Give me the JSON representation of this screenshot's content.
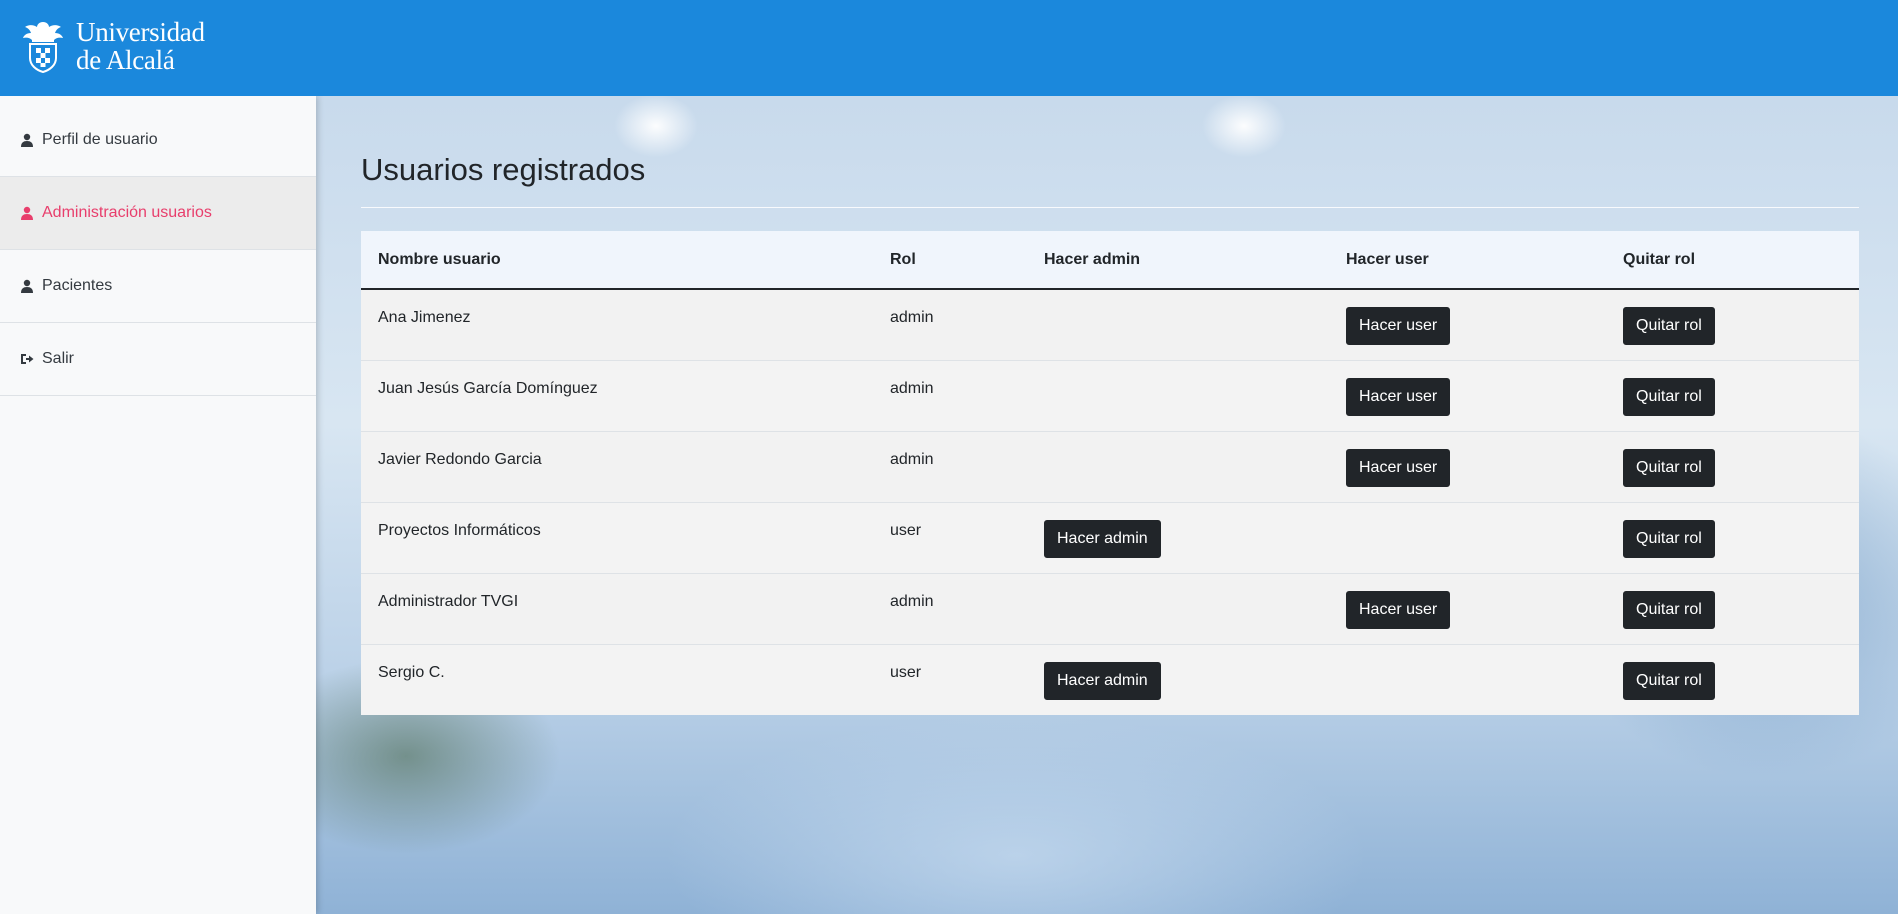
{
  "header": {
    "logo_line1": "Universidad",
    "logo_line2": "de Alcalá",
    "background_color": "#1b88dc"
  },
  "sidebar": {
    "items": [
      {
        "label": "Perfil de usuario",
        "icon": "user-icon",
        "active": false
      },
      {
        "label": "Administración usuarios",
        "icon": "user-icon",
        "active": true
      },
      {
        "label": "Pacientes",
        "icon": "user-icon",
        "active": false
      },
      {
        "label": "Salir",
        "icon": "sign-out-icon",
        "active": false
      }
    ],
    "active_color": "#e83e6c"
  },
  "main": {
    "title": "Usuarios registrados",
    "table": {
      "headers": [
        "Nombre usuario",
        "Rol",
        "Hacer admin",
        "Hacer user",
        "Quitar rol"
      ],
      "rows": [
        {
          "name": "Ana Jimenez",
          "role": "admin",
          "make_admin": "",
          "make_user": "Hacer user",
          "remove_role": "Quitar rol"
        },
        {
          "name": "Juan Jesús García Domínguez",
          "role": "admin",
          "make_admin": "",
          "make_user": "Hacer user",
          "remove_role": "Quitar rol"
        },
        {
          "name": "Javier Redondo Garcia",
          "role": "admin",
          "make_admin": "",
          "make_user": "Hacer user",
          "remove_role": "Quitar rol"
        },
        {
          "name": "Proyectos Informáticos",
          "role": "user",
          "make_admin": "Hacer admin",
          "make_user": "",
          "remove_role": "Quitar rol"
        },
        {
          "name": "Administrador TVGI",
          "role": "admin",
          "make_admin": "",
          "make_user": "Hacer user",
          "remove_role": "Quitar rol"
        },
        {
          "name": "Sergio C.",
          "role": "user",
          "make_admin": "Hacer admin",
          "make_user": "",
          "remove_role": "Quitar rol"
        }
      ]
    },
    "button_color": "#212529"
  }
}
